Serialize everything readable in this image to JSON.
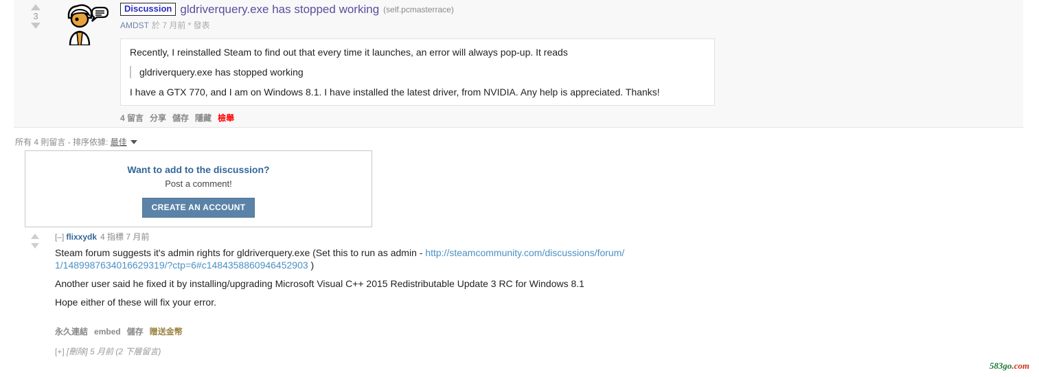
{
  "post": {
    "score": "3",
    "flair": "Discussion",
    "title": "gldriverquery.exe has stopped working",
    "domain": "(self.pcmasterrace)",
    "author": "AMDST",
    "meta": "於 7 月前 * 發表",
    "body": {
      "para1": "Recently, I reinstalled Steam to find out that every time it launches, an error will always pop-up. It reads",
      "quote": "gldriverquery.exe has stopped working",
      "para2": "I have a GTX 770, and I am on Windows 8.1. I have installed the latest driver, from NVIDIA. Any help is appreciated. Thanks!"
    },
    "links": {
      "comments": "4 留言",
      "share": "分享",
      "save": "儲存",
      "hide": "隱藏",
      "report": "檢舉"
    },
    "thumbnail_icon": "self-post-speech-bubble-icon"
  },
  "sortbar": {
    "count_label": "所有 4 則留言",
    "separator": "-",
    "sort_label": "排序依據:",
    "sort_value": "最佳",
    "caret_icon": "chevron-down-icon"
  },
  "signup": {
    "title": "Want to add to the discussion?",
    "subtitle": "Post a comment!",
    "button": "CREATE AN ACCOUNT",
    "button_color": "#5b83a8"
  },
  "comment": {
    "collapse_toggle": "[–]",
    "author": "flixxydk",
    "points": "4 指標 7 月前",
    "body": {
      "para1_before": "Steam forum suggests it's admin rights for gldriverquery.exe (Set this to run as admin - ",
      "link": "http://steamcommunity.com/discussions/forum/1/1489987634016629319/?ctp=6#c1484358860946452903",
      "para1_after": " )",
      "para2": "Another user said he fixed it by installing/upgrading Microsoft Visual C++ 2015 Redistributable Update 3 RC for Windows 8.1",
      "para3": "Hope either of these will fix your error."
    },
    "footer": {
      "permalink": "永久連結",
      "embed": "embed",
      "save": "儲存",
      "gild": "贈送金幣"
    },
    "collapsed_child": {
      "expand": "[+]",
      "deleted": "[刪除]",
      "time": "5 月前",
      "replies": "(2 下層留言)"
    }
  },
  "watermark": {
    "part_a": "583go",
    "part_b": ".com"
  }
}
